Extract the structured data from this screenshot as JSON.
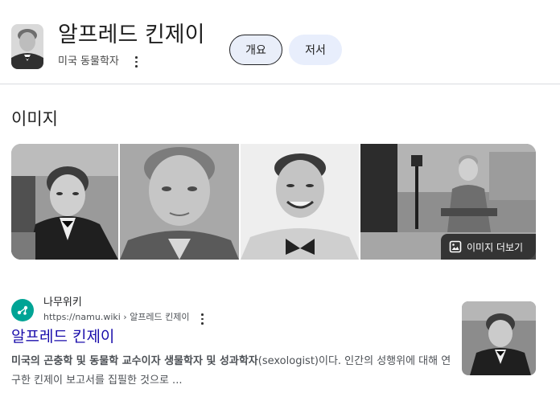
{
  "header": {
    "title": "알프레드 킨제이",
    "subtitle": "미국 동물학자",
    "chips": [
      "개요",
      "저서"
    ]
  },
  "images": {
    "section_title": "이미지",
    "more_label": "이미지 더보기"
  },
  "result": {
    "site_name": "나무위키",
    "site_url": "https://namu.wiki › 알프레드 킨제이",
    "title": "알프레드 킨제이",
    "snippet_bold": "미국의 곤충학 및 동물학 교수이자 생물학자 및 성과학자",
    "snippet_rest": "(sexologist)이다. 인간의 성행위에 대해 연구한 킨제이 보고서를 집필한 것으로 ..."
  },
  "colors": {
    "link": "#1a0dab",
    "chip_bg": "#e8eefc",
    "site_icon": "#00a495"
  }
}
